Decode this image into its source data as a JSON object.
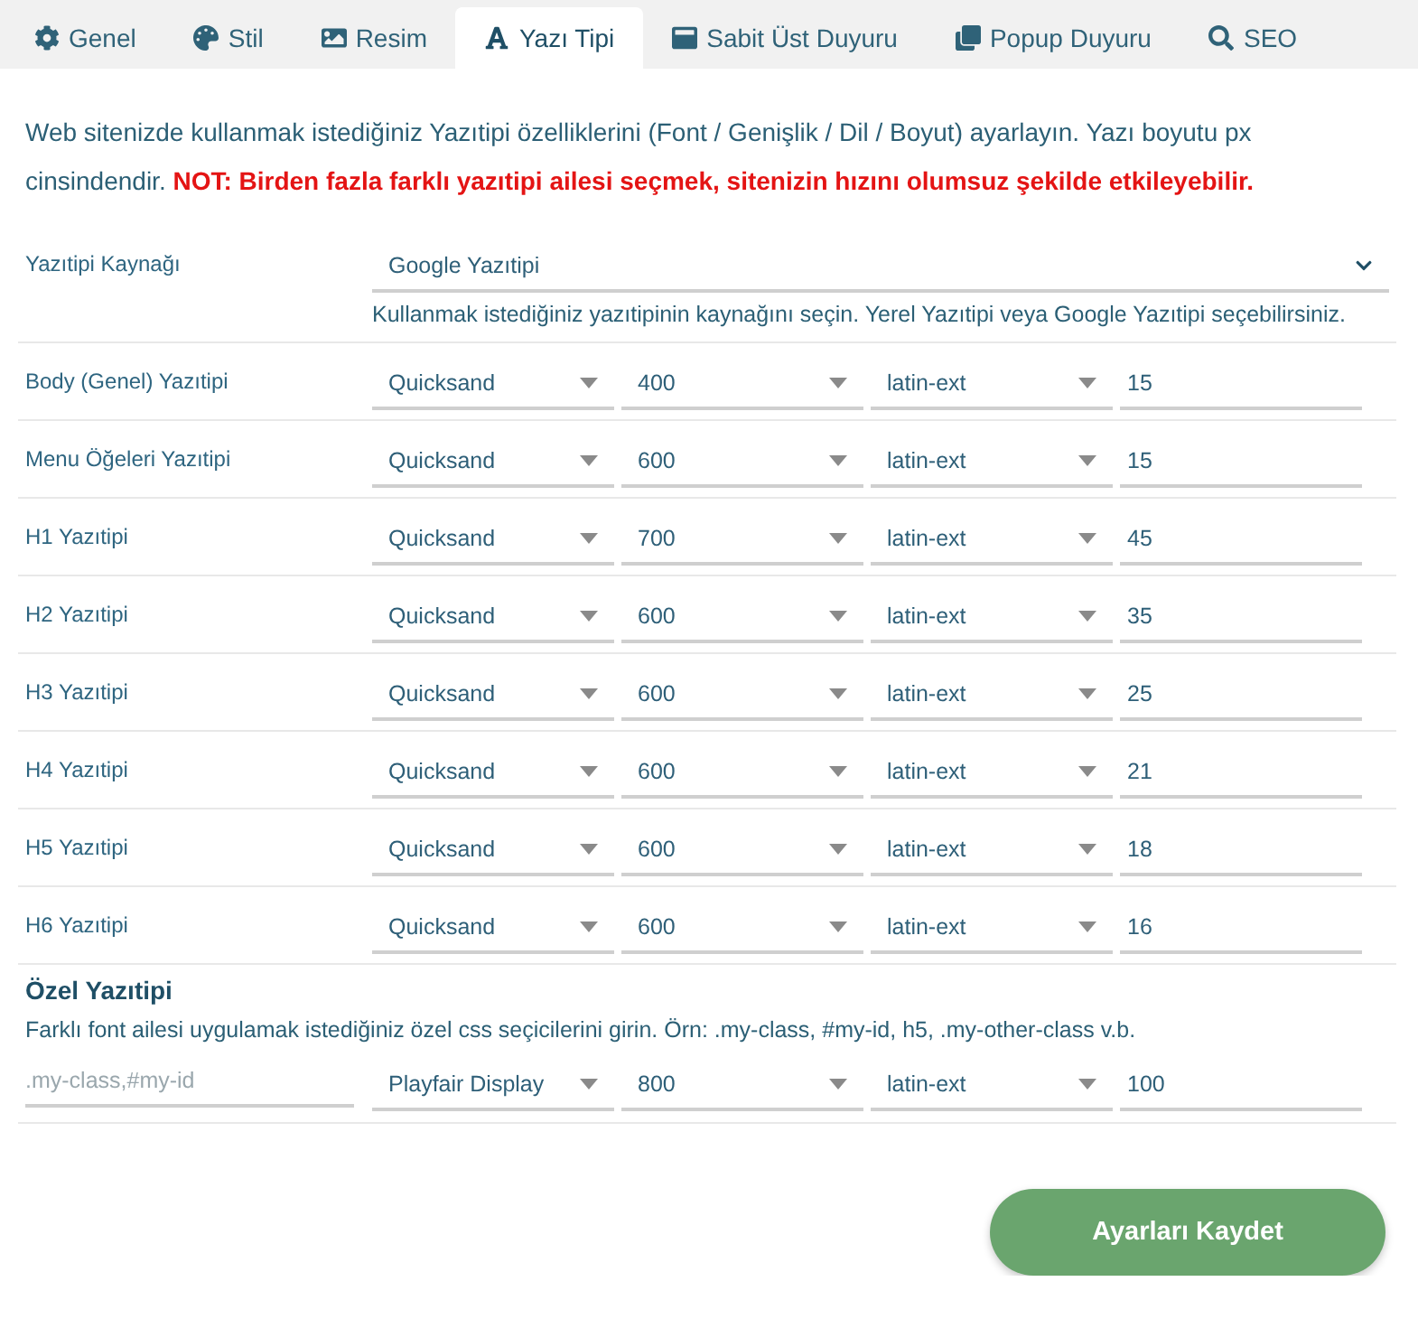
{
  "tabs": [
    {
      "label": "Genel",
      "selected": false
    },
    {
      "label": "Stil",
      "selected": false
    },
    {
      "label": "Resim",
      "selected": false
    },
    {
      "label": "Yazı Tipi",
      "selected": true
    },
    {
      "label": "Sabit Üst Duyuru",
      "selected": false
    },
    {
      "label": "Popup Duyuru",
      "selected": false
    },
    {
      "label": "SEO",
      "selected": false
    }
  ],
  "intro": {
    "text": "Web sitenizde kullanmak istediğiniz Yazıtipi özelliklerini (Font / Genişlik / Dil / Boyut) ayarlayın. Yazı boyutu px cinsindendir.",
    "warning": "NOT: Birden fazla farklı yazıtipi ailesi seçmek, sitenizin hızını olumsuz şekilde etkileyebilir."
  },
  "source": {
    "label": "Yazıtipi Kaynağı",
    "value": "Google Yazıtipi",
    "help": "Kullanmak istediğiniz yazıtipinin kaynağını seçin. Yerel Yazıtipi veya Google Yazıtipi seçebilirsiniz."
  },
  "font_rows": [
    {
      "label": "Body (Genel) Yazıtipi",
      "family": "Quicksand",
      "weight": "400",
      "subset": "latin-ext",
      "size": "15"
    },
    {
      "label": "Menu Öğeleri Yazıtipi",
      "family": "Quicksand",
      "weight": "600",
      "subset": "latin-ext",
      "size": "15"
    },
    {
      "label": "H1 Yazıtipi",
      "family": "Quicksand",
      "weight": "700",
      "subset": "latin-ext",
      "size": "45"
    },
    {
      "label": "H2 Yazıtipi",
      "family": "Quicksand",
      "weight": "600",
      "subset": "latin-ext",
      "size": "35"
    },
    {
      "label": "H3 Yazıtipi",
      "family": "Quicksand",
      "weight": "600",
      "subset": "latin-ext",
      "size": "25"
    },
    {
      "label": "H4 Yazıtipi",
      "family": "Quicksand",
      "weight": "600",
      "subset": "latin-ext",
      "size": "21"
    },
    {
      "label": "H5 Yazıtipi",
      "family": "Quicksand",
      "weight": "600",
      "subset": "latin-ext",
      "size": "18"
    },
    {
      "label": "H6 Yazıtipi",
      "family": "Quicksand",
      "weight": "600",
      "subset": "latin-ext",
      "size": "16"
    }
  ],
  "custom": {
    "title": "Özel Yazıtipi",
    "description": "Farklı font ailesi uygulamak istediğiniz özel css seçicilerini girin. Örn: .my-class, #my-id, h5, .my-other-class v.b.",
    "selector": {
      "placeholder": ".my-class,#my-id"
    },
    "family": "Playfair Display",
    "weight": "800",
    "subset": "latin-ext",
    "size": "100"
  },
  "save_button": "Ayarları Kaydet"
}
